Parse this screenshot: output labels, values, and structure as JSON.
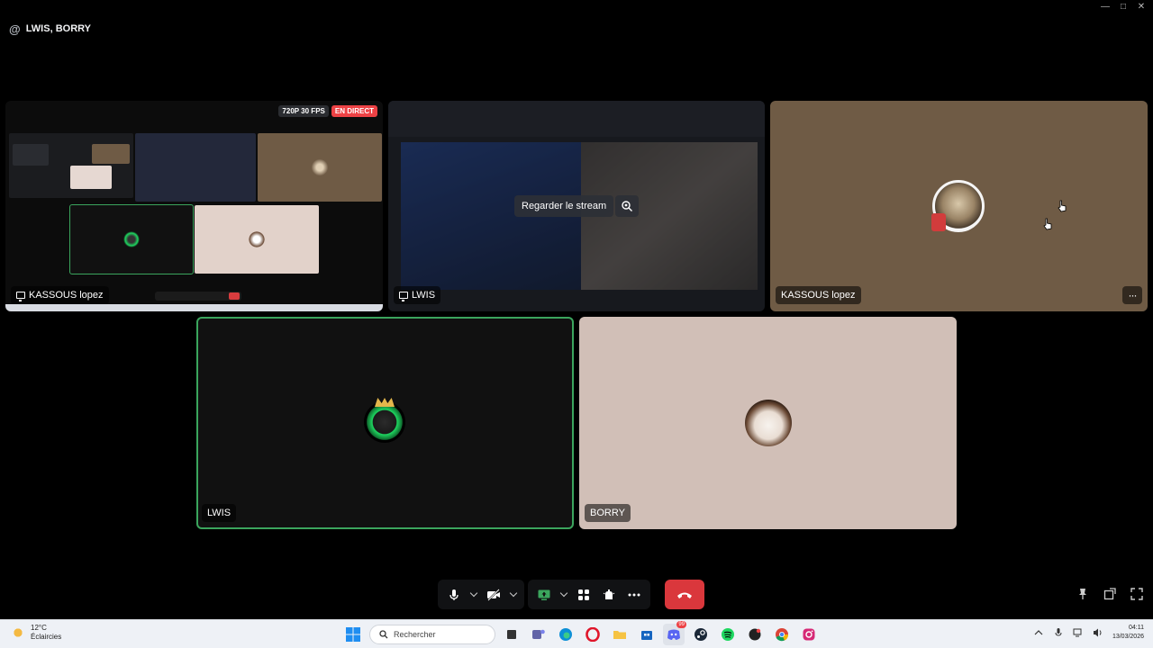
{
  "window": {
    "controls": [
      "—",
      "□",
      "✕"
    ]
  },
  "call": {
    "header_icon": "at-icon",
    "title": "LWIS, BORRY"
  },
  "tiles": {
    "screenshare": {
      "quality_badge": "720P 30 FPS",
      "live_badge": "EN DIRECT",
      "label": "KASSOUS lopez"
    },
    "stream_preview": {
      "watch_button": "Regarder le stream",
      "label": "LWIS"
    },
    "kassous": {
      "label": "KASSOUS lopez",
      "more_button": "···"
    },
    "lwis": {
      "label": "LWIS",
      "speaking": true
    },
    "borry": {
      "label": "BORRY"
    }
  },
  "controls": {
    "mic_icon": "microphone-icon",
    "camera_icon": "camera-off-icon",
    "screen_share_icon": "screen-share-icon",
    "activities_icon": "activities-icon",
    "soundboard_icon": "soundboard-icon",
    "more_icon": "more-icon",
    "hangup_icon": "hangup-icon"
  },
  "taskbar": {
    "weather_temp": "12°C",
    "weather_desc": "Éclaircies",
    "search_placeholder": "Rechercher",
    "time": "04:11",
    "date": "13/03/2026",
    "notification_count": "99"
  },
  "colors": {
    "speaking_outline": "#3ba55d",
    "live_badge": "#ed4245",
    "hangup": "#da373c",
    "kassous_tile": "#6f5b45",
    "borry_tile": "#d1bfb7"
  }
}
